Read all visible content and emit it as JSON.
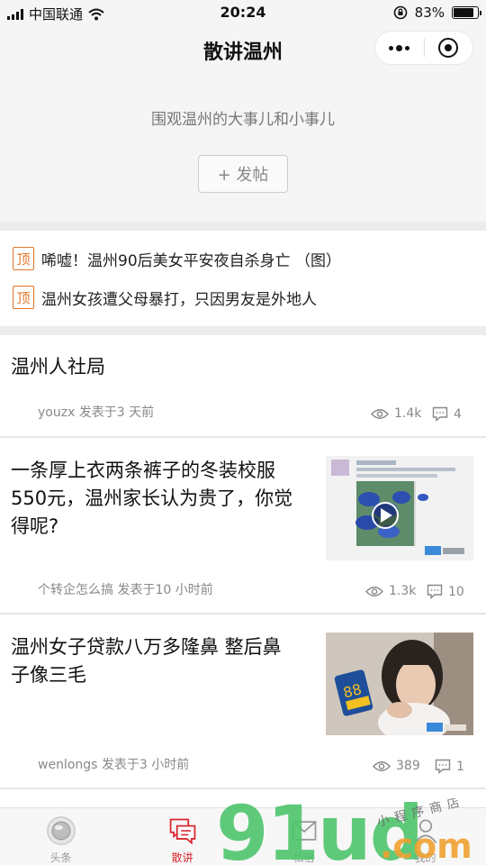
{
  "status_bar": {
    "carrier": "中国联通",
    "time": "20:24",
    "battery": "83%",
    "battery_level": 0.83
  },
  "header": {
    "title": "散讲温州",
    "subtitle": "围观温州的大事儿和小事儿",
    "post_button": "+ 发帖"
  },
  "pinned": {
    "tag": "顶",
    "items": [
      "唏嘘！温州90后美女平安夜自杀身亡 （图）",
      "温州女孩遭父母暴打，只因男友是外地人"
    ]
  },
  "feed": [
    {
      "title": "温州人社局",
      "author_line": "youzx 发表于3 天前",
      "views": "1.4k",
      "comments": "4"
    },
    {
      "title_lines": [
        "一条厚上衣两条裤子的冬装校服",
        "550元，温州家长认为贵了，你觉",
        "得呢?"
      ],
      "author_line": "个转企怎么搞 发表于10 小时前",
      "views": "1.3k",
      "comments": "10"
    },
    {
      "title_lines": [
        "温州女子贷款八万多隆鼻 整后鼻",
        "子像三毛"
      ],
      "author_line": "wenlongs 发表于3 小时前",
      "views": "389",
      "comments": "1"
    }
  ],
  "tab_bar": {
    "tabs": [
      {
        "label": "头条",
        "icon": "headline-icon"
      },
      {
        "label": "散讲",
        "icon": "chat-bubbles-icon",
        "active": true
      },
      {
        "label": "私信",
        "icon": "message-icon"
      },
      {
        "label": "我的",
        "icon": "profile-icon"
      }
    ]
  },
  "watermark": {
    "text": "91ud",
    "suffix": ".com",
    "tagline": "小程序商店"
  },
  "colors": {
    "accent": "#d9272e",
    "pin_tag": "#e0782a",
    "watermark_green": "#4ec36b",
    "watermark_orange": "#f0a030"
  }
}
